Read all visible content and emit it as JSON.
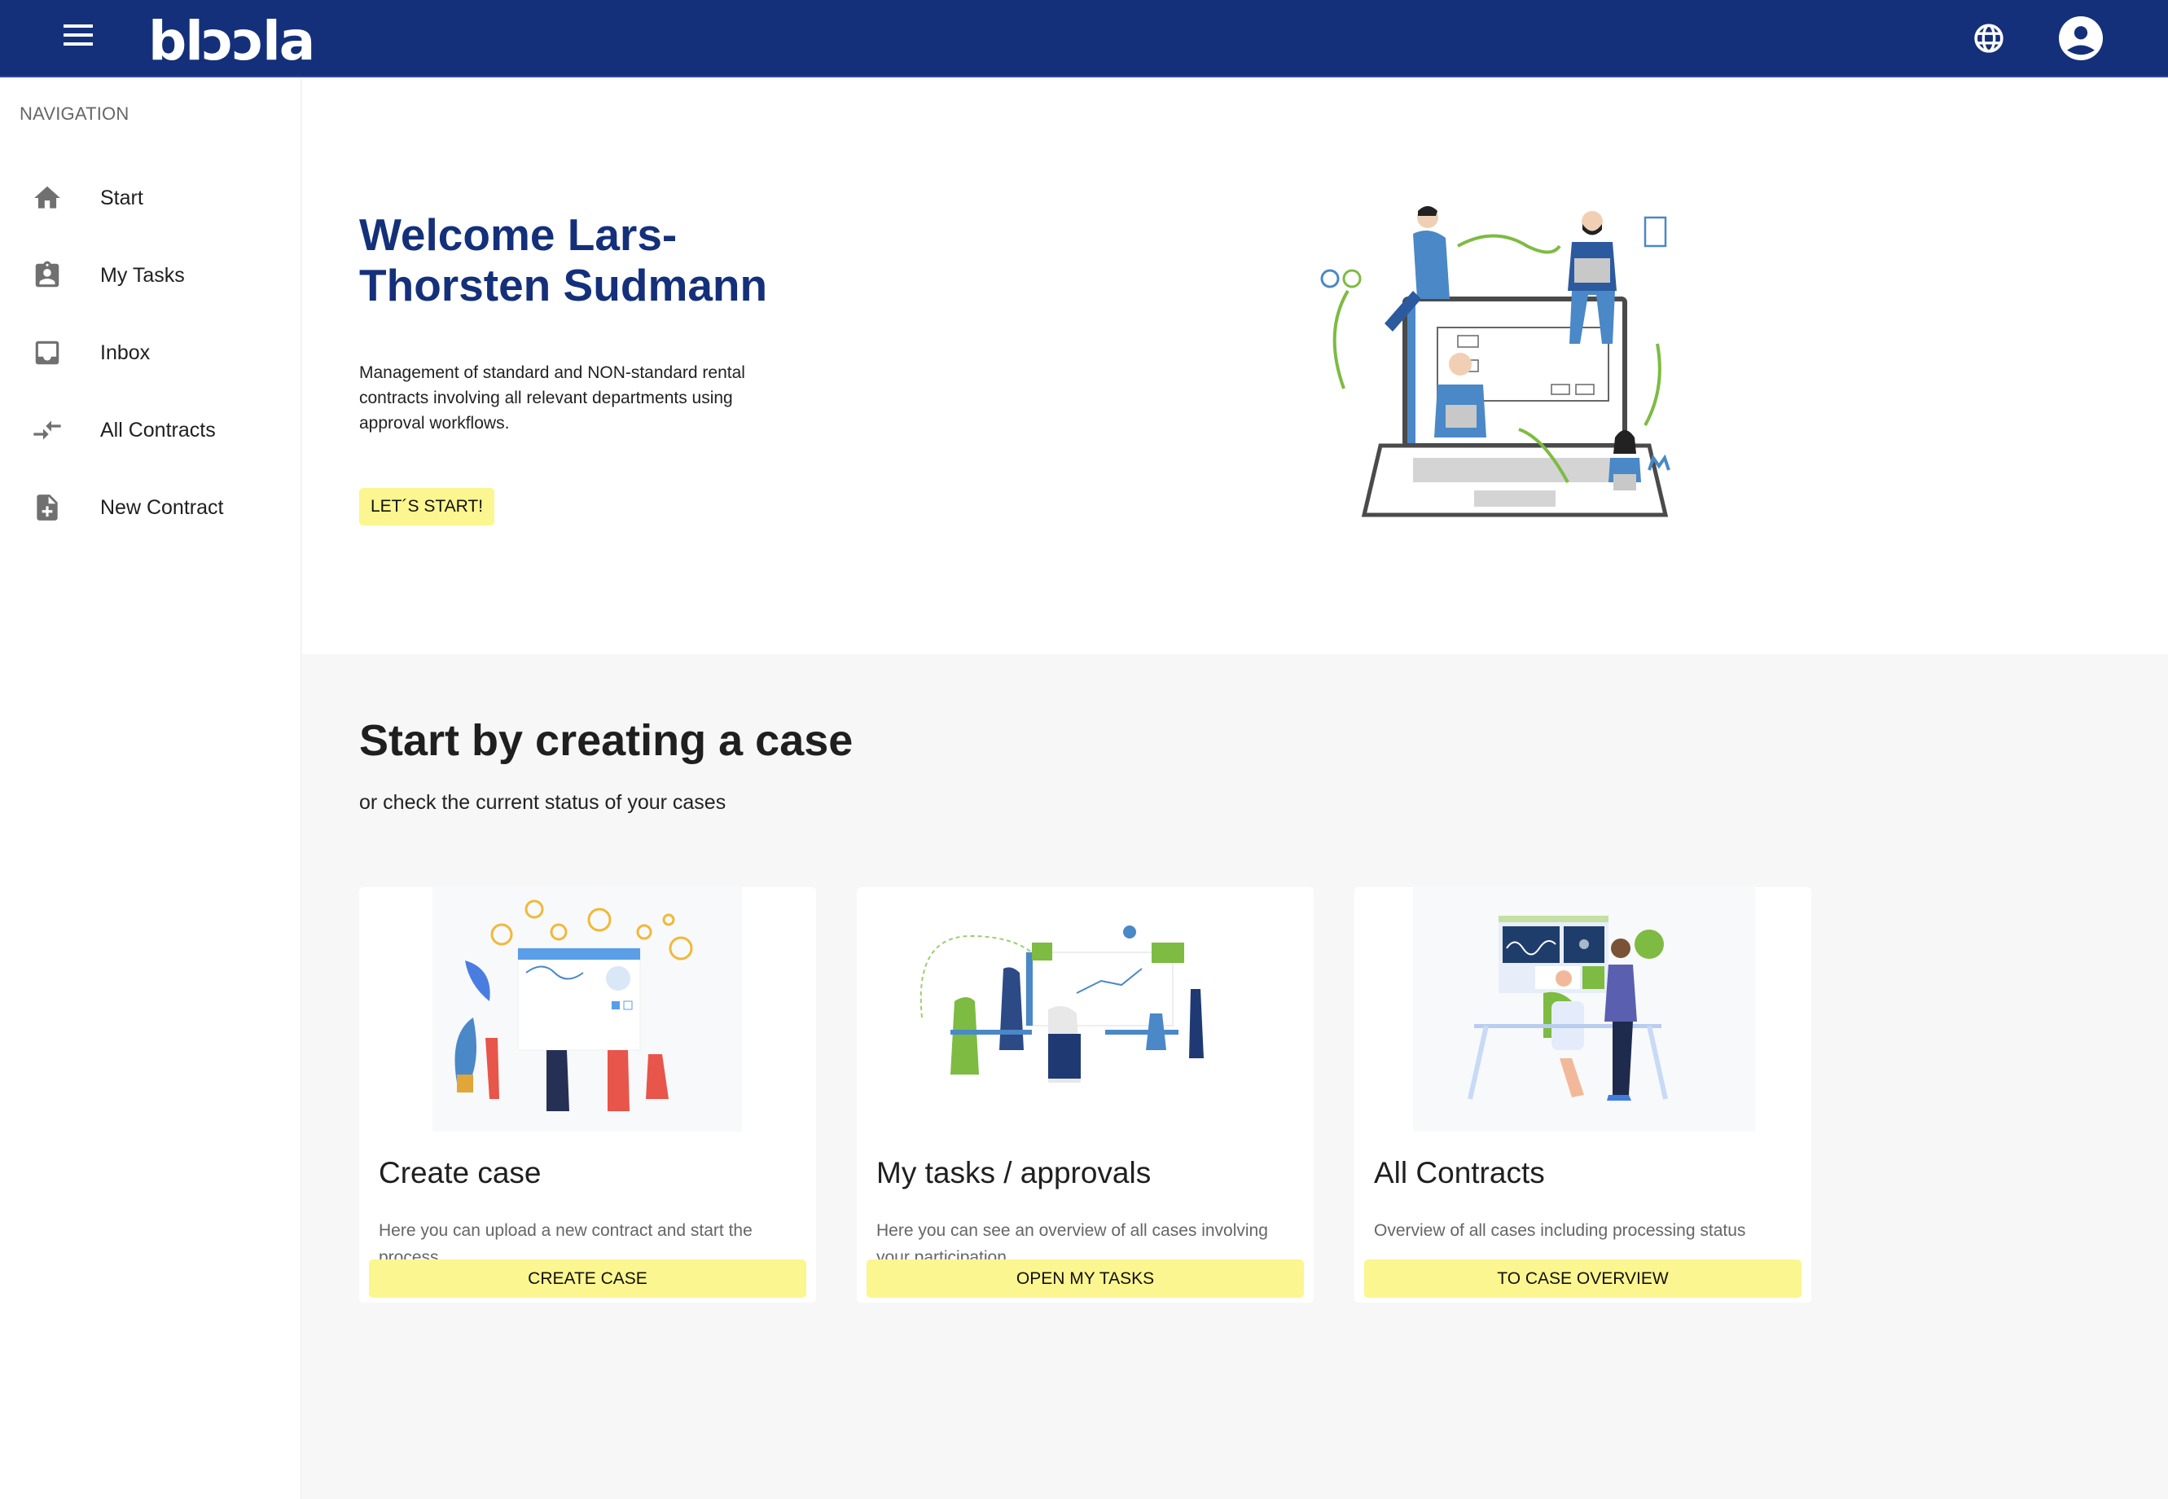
{
  "header": {
    "brand": "blɔɔla",
    "menu_icon": "hamburger-menu-icon",
    "language_icon": "globe-icon",
    "account_icon": "account-circle-icon",
    "bg_color": "#14307a"
  },
  "sidebar": {
    "heading": "NAVIGATION",
    "items": [
      {
        "label": "Start",
        "icon": "home-icon"
      },
      {
        "label": "My Tasks",
        "icon": "assignment-ind-icon"
      },
      {
        "label": "Inbox",
        "icon": "inbox-icon"
      },
      {
        "label": "All Contracts",
        "icon": "compare-arrows-icon"
      },
      {
        "label": "New Contract",
        "icon": "note-add-icon"
      }
    ]
  },
  "hero": {
    "title": "Welcome Lars-Thorsten Sudmann",
    "description": "Management of standard and NON-standard rental contracts involving all relevant departments using approval workflows.",
    "button": "LET´S START!",
    "accent_color": "#fbf68f"
  },
  "section": {
    "title": "Start by creating a case",
    "subtitle": "or check the current status of your cases",
    "cards": [
      {
        "title": "Create case",
        "description": "Here you can upload a new contract and start the process",
        "button": "CREATE CASE"
      },
      {
        "title": "My tasks / approvals",
        "description": "Here you can see an overview of all cases involving your participation",
        "button": "OPEN MY TASKS"
      },
      {
        "title": "All Contracts",
        "description": "Overview of all cases including processing status",
        "button": "TO CASE OVERVIEW"
      }
    ]
  }
}
